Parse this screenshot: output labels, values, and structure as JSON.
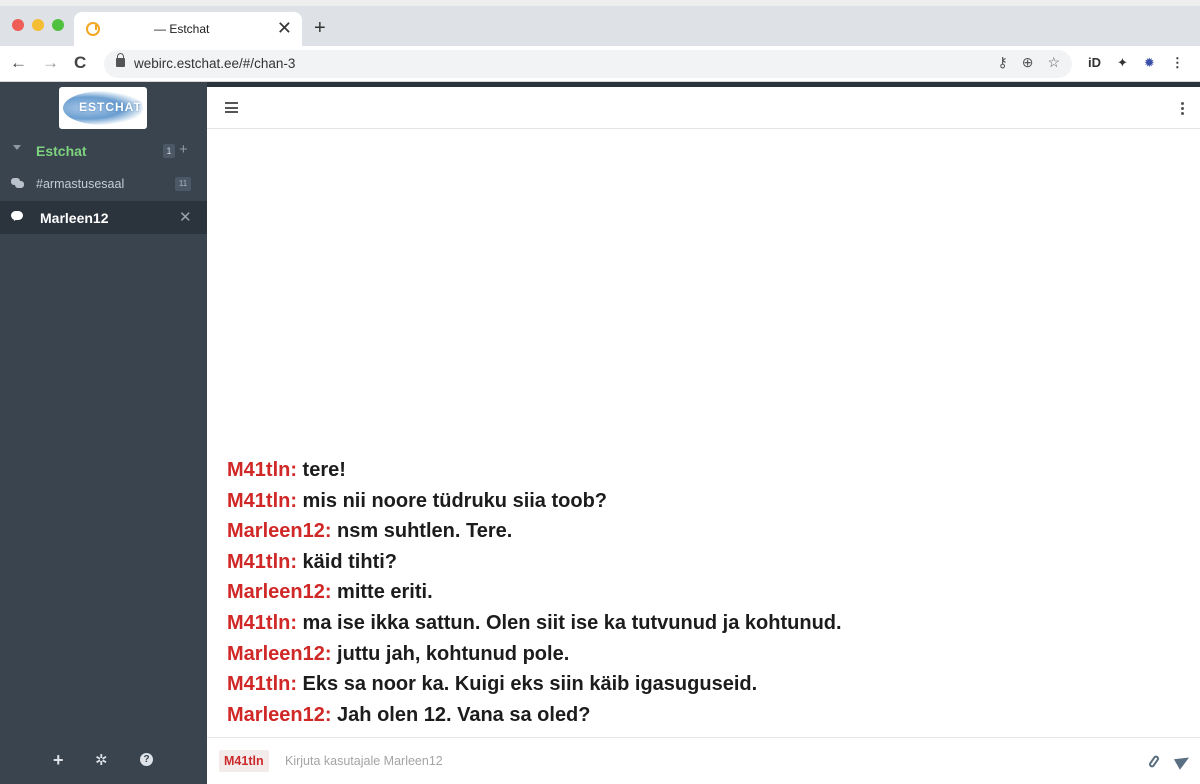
{
  "browser": {
    "tab_title": "— Estchat",
    "tab_close": "✕",
    "new_tab": "+",
    "url": "webirc.estchat.ee/#/chan-3",
    "back": "←",
    "forward": "→",
    "reload": "C",
    "url_icons": [
      "⚷",
      "⊕",
      "☆"
    ],
    "extension_icons": [
      "iD",
      "✦",
      "✹",
      "⋮"
    ]
  },
  "sidebar": {
    "logo_text": "ESTCHAT",
    "network": {
      "name": "Estchat",
      "badge": "1",
      "add": "+"
    },
    "channels": [
      {
        "name": "#armastusesaal",
        "badge": "11"
      }
    ],
    "active_query": {
      "name": "Marleen12",
      "close": "✕"
    },
    "footer": {
      "add": "+",
      "settings": "✲",
      "help": "?"
    }
  },
  "messages": [
    {
      "nick": "M41tln:",
      "text": " tere!"
    },
    {
      "nick": "M41tln:",
      "text": " mis nii noore tüdruku siia toob?"
    },
    {
      "nick": "Marleen12:",
      "text": " nsm suhtlen. Tere."
    },
    {
      "nick": "M41tln:",
      "text": " käid tihti?"
    },
    {
      "nick": "Marleen12:",
      "text": " mitte eriti."
    },
    {
      "nick": "M41tln:",
      "text": " ma ise ikka sattun. Olen siit ise ka tutvunud ja kohtunud."
    },
    {
      "nick": "Marleen12:",
      "text": " juttu jah, kohtunud pole."
    },
    {
      "nick": "M41tln:",
      "text": " Eks sa noor ka. Kuigi eks siin käib igasuguseid."
    },
    {
      "nick": "Marleen12:",
      "text": " Jah olen 12. Vana sa oled?"
    }
  ],
  "input": {
    "nick": "M41tln",
    "placeholder": "Kirjuta kasutajale Marleen12"
  }
}
